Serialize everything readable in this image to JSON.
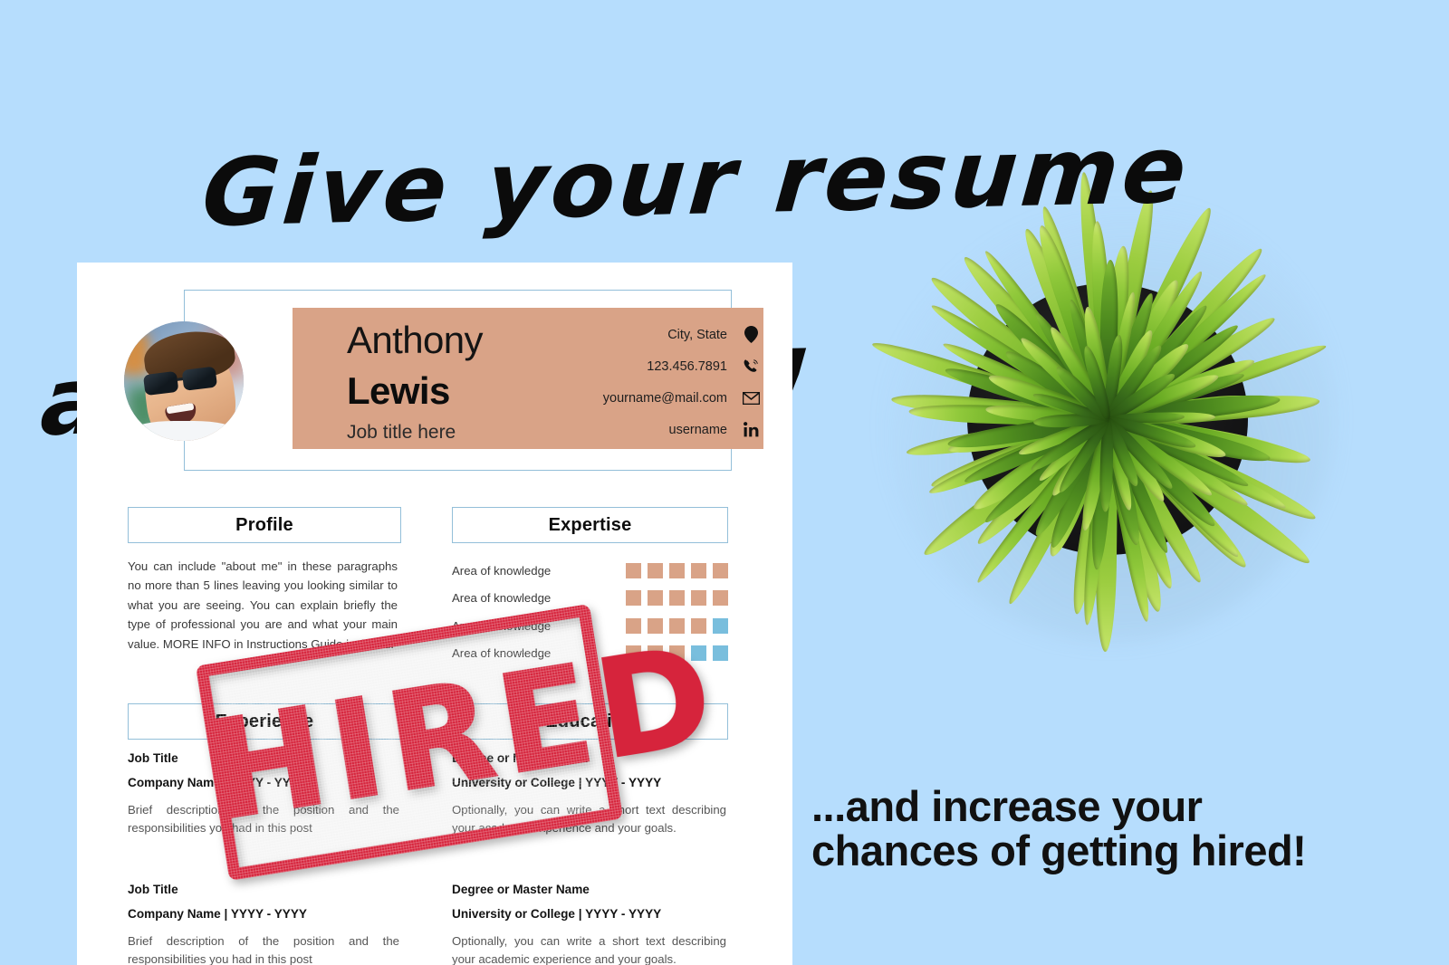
{
  "promo": {
    "headline_line1": "Give your resume",
    "headline_line2": "a makeover!!",
    "tagline_line1": "...and increase your",
    "tagline_line2": "chances of getting hired!",
    "stamp_text": "HIRED",
    "background_color": "#b6ddfd",
    "accent_color": "#d9a387",
    "stamp_color": "#d6243c",
    "border_color": "#93bfd9"
  },
  "resume": {
    "header": {
      "first_name": "Anthony",
      "last_name": "Lewis",
      "job_title": "Job title here",
      "contacts": [
        {
          "icon": "location-pin-icon",
          "value": "City, State"
        },
        {
          "icon": "phone-icon",
          "value": "123.456.7891"
        },
        {
          "icon": "envelope-icon",
          "value": "yourname@mail.com"
        },
        {
          "icon": "linkedin-icon",
          "value": "username"
        }
      ]
    },
    "profile": {
      "heading": "Profile",
      "body": "You can include \"about me\" in these paragraphs no more than 5 lines leaving you looking similar to what you are seeing. You can explain briefly the type of professional you are and what your main value. MORE INFO in Instructions Guide included."
    },
    "expertise": {
      "heading": "Expertise",
      "skills": [
        {
          "label": "Area of knowledge",
          "filled": 5,
          "total": 5
        },
        {
          "label": "Area of knowledge",
          "filled": 5,
          "total": 5
        },
        {
          "label": "Area of knowledge",
          "filled": 4,
          "total": 5
        },
        {
          "label": "Area of knowledge",
          "filled": 3,
          "total": 5
        }
      ]
    },
    "experience": {
      "heading": "Experience",
      "entries": [
        {
          "title": "Job Title",
          "meta": "Company Name | YYYY - YYYY",
          "description": "Brief description of the position and the responsibilities you had in this post"
        },
        {
          "title": "Job Title",
          "meta": "Company Name | YYYY - YYYY",
          "description": "Brief description of the position and the responsibilities you had in this post"
        }
      ]
    },
    "education": {
      "heading": "Education",
      "entries": [
        {
          "title": "Degree or Master Name",
          "meta": "University or College | YYYY - YYYY",
          "description": "Optionally, you can write a short text describing your academic experience and your goals."
        },
        {
          "title": "Degree or Master Name",
          "meta": "University or College | YYYY - YYYY",
          "description": "Optionally, you can write a short text describing your academic experience and your goals."
        }
      ]
    }
  }
}
